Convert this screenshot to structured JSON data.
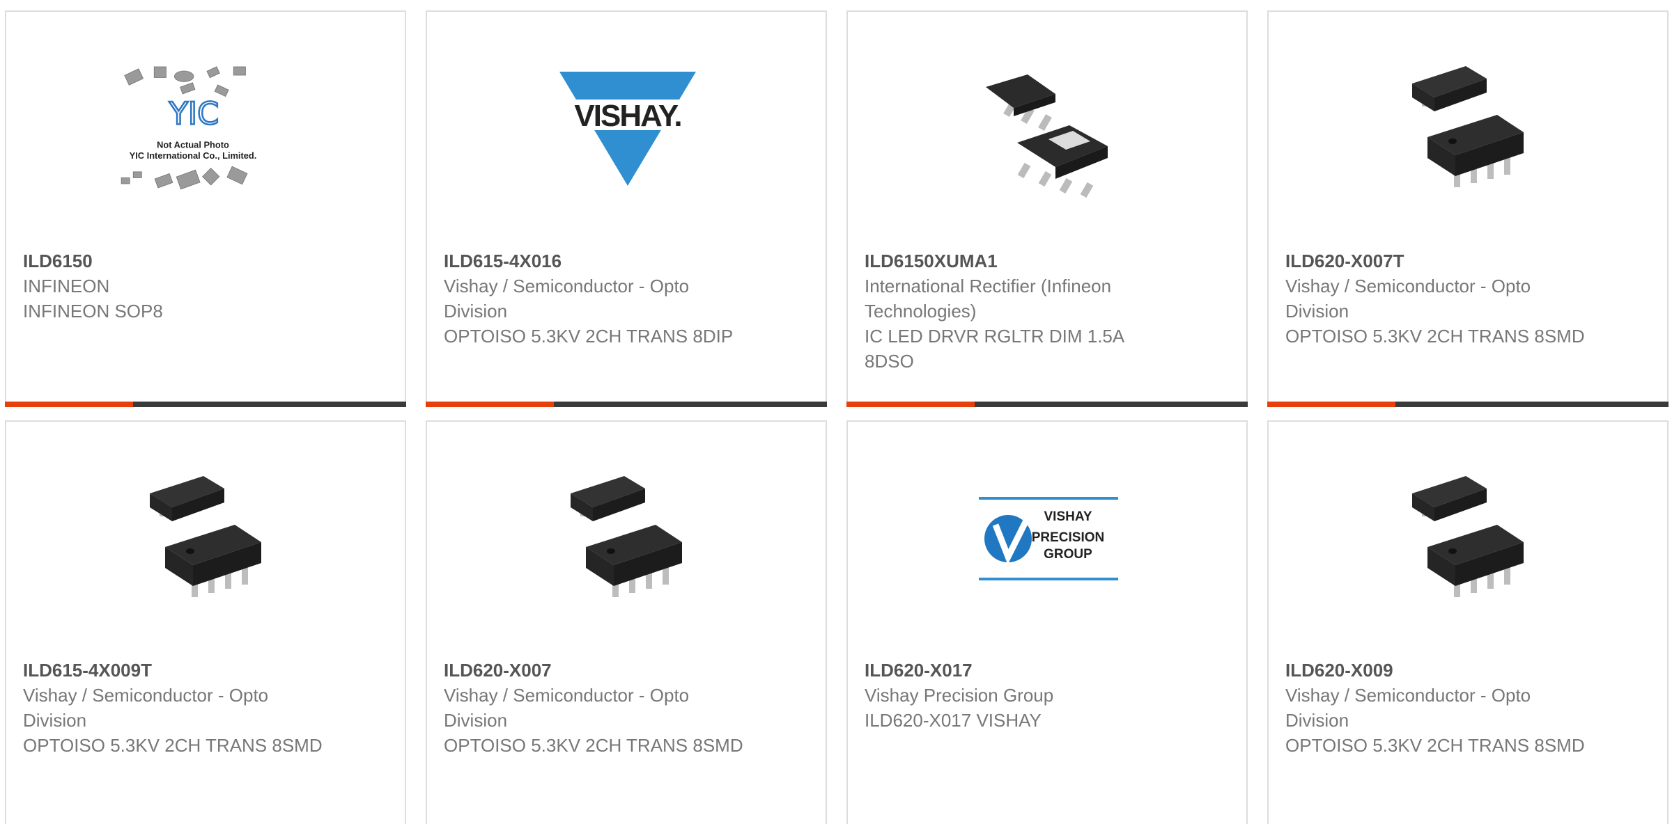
{
  "colors": {
    "accent": "#e8400c",
    "bar": "#3a3a3a",
    "border": "#dddddd"
  },
  "products": [
    {
      "part": "ILD6150",
      "manufacturer": "INFINEON",
      "description": "INFINEON SOP8",
      "image": "yic-placeholder",
      "placeholder": {
        "title": "Not Actual Photo",
        "subtitle": "YIC International Co., Limited."
      }
    },
    {
      "part": "ILD615-4X016",
      "manufacturer": "Vishay / Semiconductor - Opto Division",
      "description": "OPTOISO 5.3KV 2CH TRANS 8DIP",
      "image": "vishay-logo",
      "logo_text": "VISHAY."
    },
    {
      "part": "ILD6150XUMA1",
      "manufacturer": "International Rectifier (Infineon Technologies)",
      "description": "IC LED DRVR RGLTR DIM 1.5A 8DSO",
      "image": "chip-soic8"
    },
    {
      "part": "ILD620-X007T",
      "manufacturer": "Vishay / Semiconductor - Opto Division",
      "description": "OPTOISO 5.3KV 2CH TRANS 8SMD",
      "image": "chip-smd8"
    },
    {
      "part": "ILD615-4X009T",
      "manufacturer": "Vishay / Semiconductor - Opto Division",
      "description": "OPTOISO 5.3KV 2CH TRANS 8SMD",
      "image": "chip-smd8"
    },
    {
      "part": "ILD620-X007",
      "manufacturer": "Vishay / Semiconductor - Opto Division",
      "description": "OPTOISO 5.3KV 2CH TRANS 8SMD",
      "image": "chip-smd8"
    },
    {
      "part": "ILD620-X017",
      "manufacturer": "Vishay Precision Group",
      "description": "ILD620-X017 VISHAY",
      "image": "vpg-logo",
      "logo_lines": [
        "VISHAY",
        "PRECISION",
        "GROUP"
      ]
    },
    {
      "part": "ILD620-X009",
      "manufacturer": "Vishay / Semiconductor - Opto Division",
      "description": "OPTOISO 5.3KV 2CH TRANS 8SMD",
      "image": "chip-smd8"
    }
  ]
}
